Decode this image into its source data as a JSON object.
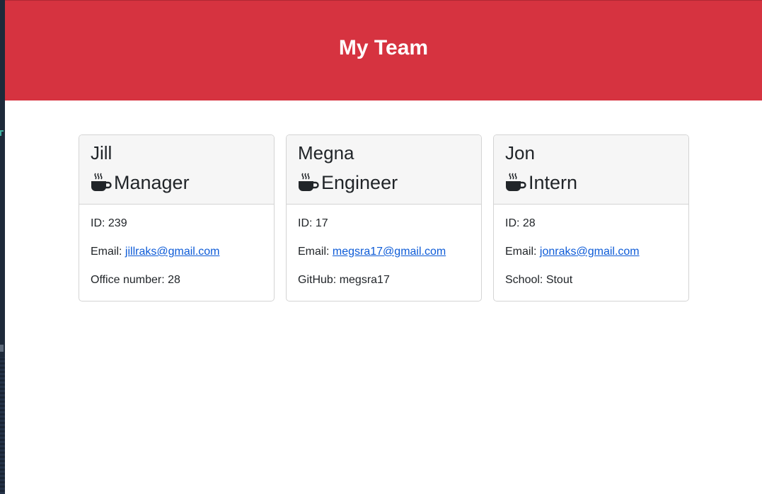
{
  "header": {
    "title": "My Team",
    "background": "#d63340"
  },
  "employees": [
    {
      "name": "Jill",
      "role": "Manager",
      "role_icon": "coffee-icon",
      "id_text": "ID: 239",
      "email_label": "Email: ",
      "email": "jillraks@gmail.com",
      "extra": "Office number: 28"
    },
    {
      "name": "Megna",
      "role": "Engineer",
      "role_icon": "coffee-icon",
      "id_text": "ID: 17",
      "email_label": "Email: ",
      "email": "megsra17@gmail.com",
      "extra": "GitHub: megsra17"
    },
    {
      "name": "Jon",
      "role": "Intern",
      "role_icon": "coffee-icon",
      "id_text": "ID: 28",
      "email_label": "Email: ",
      "email": "jonraks@gmail.com",
      "extra": "School: Stout"
    }
  ]
}
